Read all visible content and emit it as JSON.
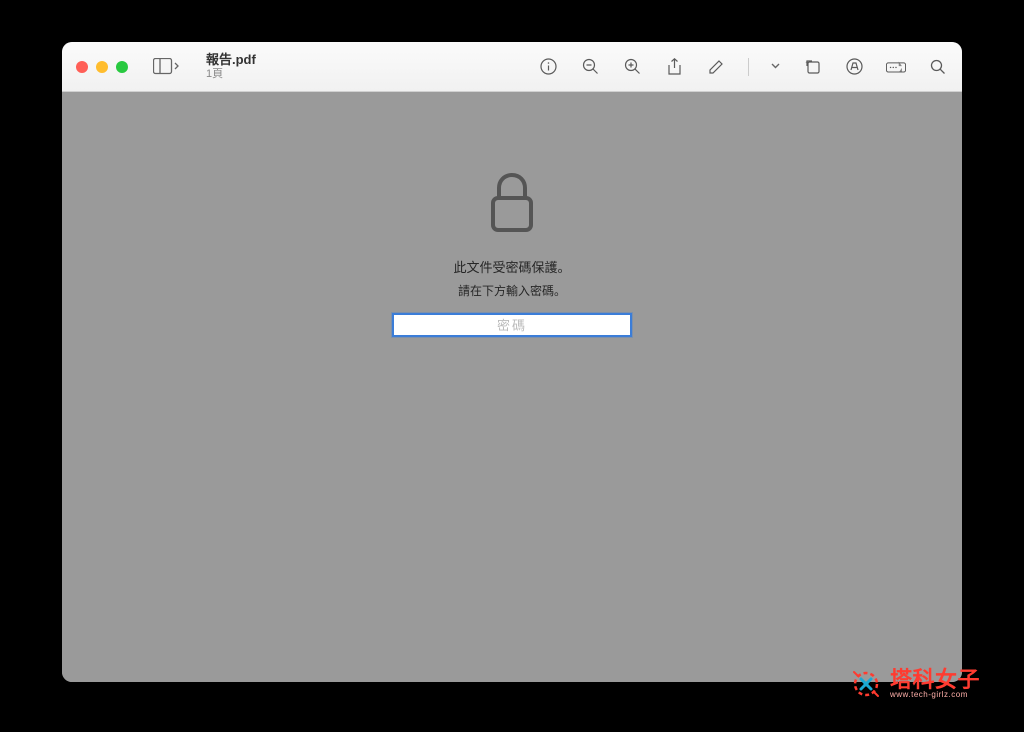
{
  "window": {
    "doc_title": "報告.pdf",
    "doc_subtitle": "1頁"
  },
  "content": {
    "protected_message": "此文件受密碼保護。",
    "instruction": "請在下方輸入密碼。",
    "password_placeholder": "密碼"
  },
  "watermark": {
    "title": "塔科女子",
    "url": "www.tech-girlz.com"
  },
  "icons": {
    "info": "info-icon",
    "zoom_out": "zoom-out-icon",
    "zoom_in": "zoom-in-icon",
    "share": "share-icon",
    "markup": "markup-icon",
    "dropdown": "chevron-down-icon",
    "rotate": "rotate-icon",
    "highlight": "highlight-icon",
    "form": "form-icon",
    "search": "search-icon",
    "sidebar": "sidebar-icon"
  }
}
